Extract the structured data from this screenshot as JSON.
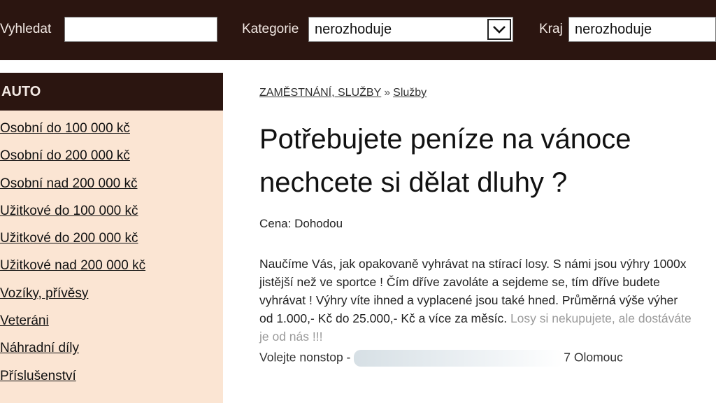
{
  "search": {
    "vyhledat_label": "Vyhledat",
    "vyhledat_value": "",
    "kategorie_label": "Kategorie",
    "kategorie_value": "nerozhoduje",
    "kraj_label": "Kraj",
    "kraj_value": "nerozhoduje"
  },
  "sidebar": {
    "heading": "AUTO",
    "items": [
      {
        "label": "Osobní do 100 000 kč"
      },
      {
        "label": "Osobní do 200 000 kč"
      },
      {
        "label": "Osobní nad 200 000 kč"
      },
      {
        "label": "Užitkové do 100 000 kč"
      },
      {
        "label": "Užitkové do 200 000 kč"
      },
      {
        "label": "Užitkové nad 200 000 kč"
      },
      {
        "label": "Vozíky, přívěsy"
      },
      {
        "label": "Veteráni"
      },
      {
        "label": "Náhradní díly"
      },
      {
        "label": "Příslušenství"
      }
    ]
  },
  "breadcrumb": {
    "parent": "ZAMĚSTNÁNÍ, SLUŽBY",
    "separator": "»",
    "current": "Služby"
  },
  "ad": {
    "title_line1": "Potřebujete peníze na vánoce",
    "title_line2": "nechcete si dělat dluhy ?",
    "price": "Cena: Dohodou",
    "description": "Naučíme Vás, jak opakovaně vyhrávat na stírací losy. S námi jsou výhry 1000x jistější než ve sportce ! Čím dříve zavoláte a sejdeme se, tím dříve budete vyhrávat ! Výhry víte ihned a vyplacené jsou také hned. Průměrná výše výher od 1.000,- Kč do 25.000,- Kč a více za měsíc.",
    "description_faded": "Losy si nekupujete, ale dostáváte je od nás !!!",
    "contact_prefix": "Volejte nonstop -",
    "contact_suffix": "7 Olomouc"
  },
  "colors": {
    "header_bg": "#2b1510",
    "sidebar_bg": "#fbe5d3"
  },
  "icons": {
    "select_arrow": "chevron-down-icon"
  }
}
